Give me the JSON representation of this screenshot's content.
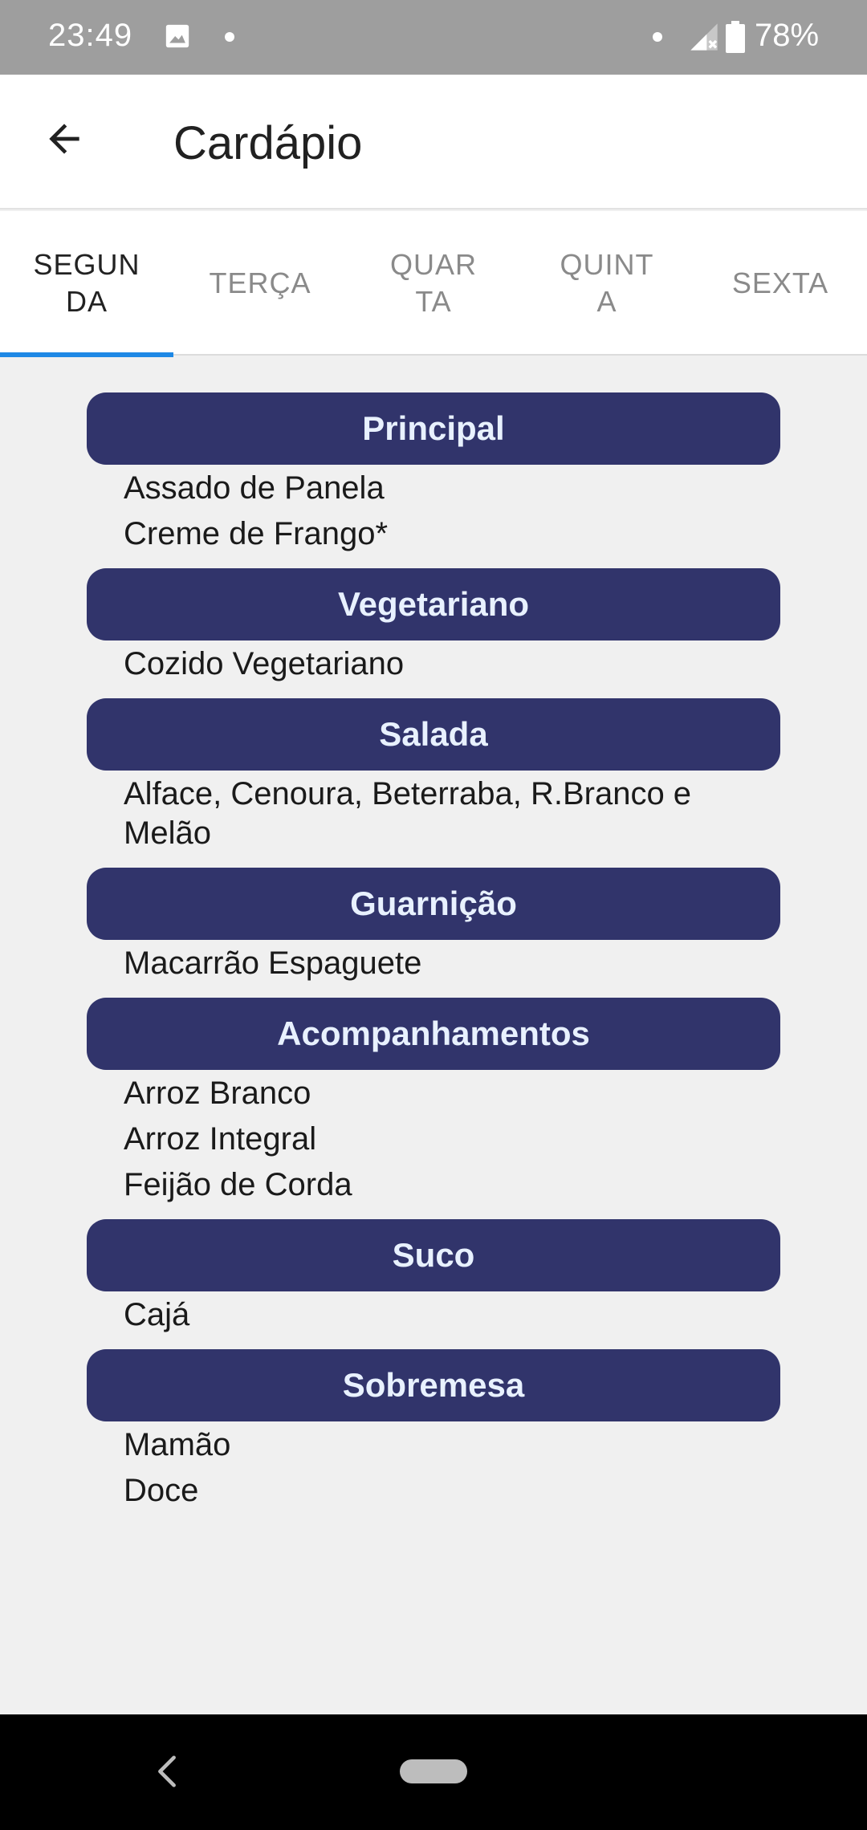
{
  "status_bar": {
    "time": "23:49",
    "battery": "78%",
    "icons": [
      "gallery-icon",
      "dot-icon",
      "dot-icon",
      "signal-icon",
      "battery-icon"
    ]
  },
  "app_bar": {
    "title": "Cardápio",
    "back_icon": "arrow-left-icon"
  },
  "tabs": [
    {
      "label": "SEGUNDA",
      "active": true
    },
    {
      "label": "TERÇA",
      "active": false
    },
    {
      "label": "QUARTA",
      "active": false
    },
    {
      "label": "QUINTA",
      "active": false
    },
    {
      "label": "SEXTA",
      "active": false
    }
  ],
  "menu": {
    "principal": {
      "title": "Principal",
      "items": [
        "Assado de Panela",
        "Creme de Frango*"
      ]
    },
    "vegetariano": {
      "title": "Vegetariano",
      "items": [
        "Cozido Vegetariano"
      ]
    },
    "salada": {
      "title": "Salada",
      "items": [
        "Alface, Cenoura, Beterraba, R.Branco e Melão"
      ]
    },
    "guarnicao": {
      "title": "Guarnição",
      "items": [
        "Macarrão Espaguete"
      ]
    },
    "acompanhamentos": {
      "title": "Acompanhamentos",
      "items": [
        "Arroz Branco",
        "Arroz Integral",
        "Feijão de Corda"
      ]
    },
    "suco": {
      "title": "Suco",
      "items": [
        "Cajá"
      ]
    },
    "sobremesa": {
      "title": "Sobremesa",
      "items": [
        "Mamão",
        "Doce"
      ]
    }
  },
  "colors": {
    "section_header_bg": "#31346b",
    "section_header_text": "#e8f1ff",
    "tab_indicator": "#1e88e5",
    "status_bar_bg": "#9e9e9e",
    "background": "#f0f0f0"
  },
  "nav_bar": {
    "icons": [
      "nav-back-icon",
      "nav-home-pill-icon"
    ]
  }
}
